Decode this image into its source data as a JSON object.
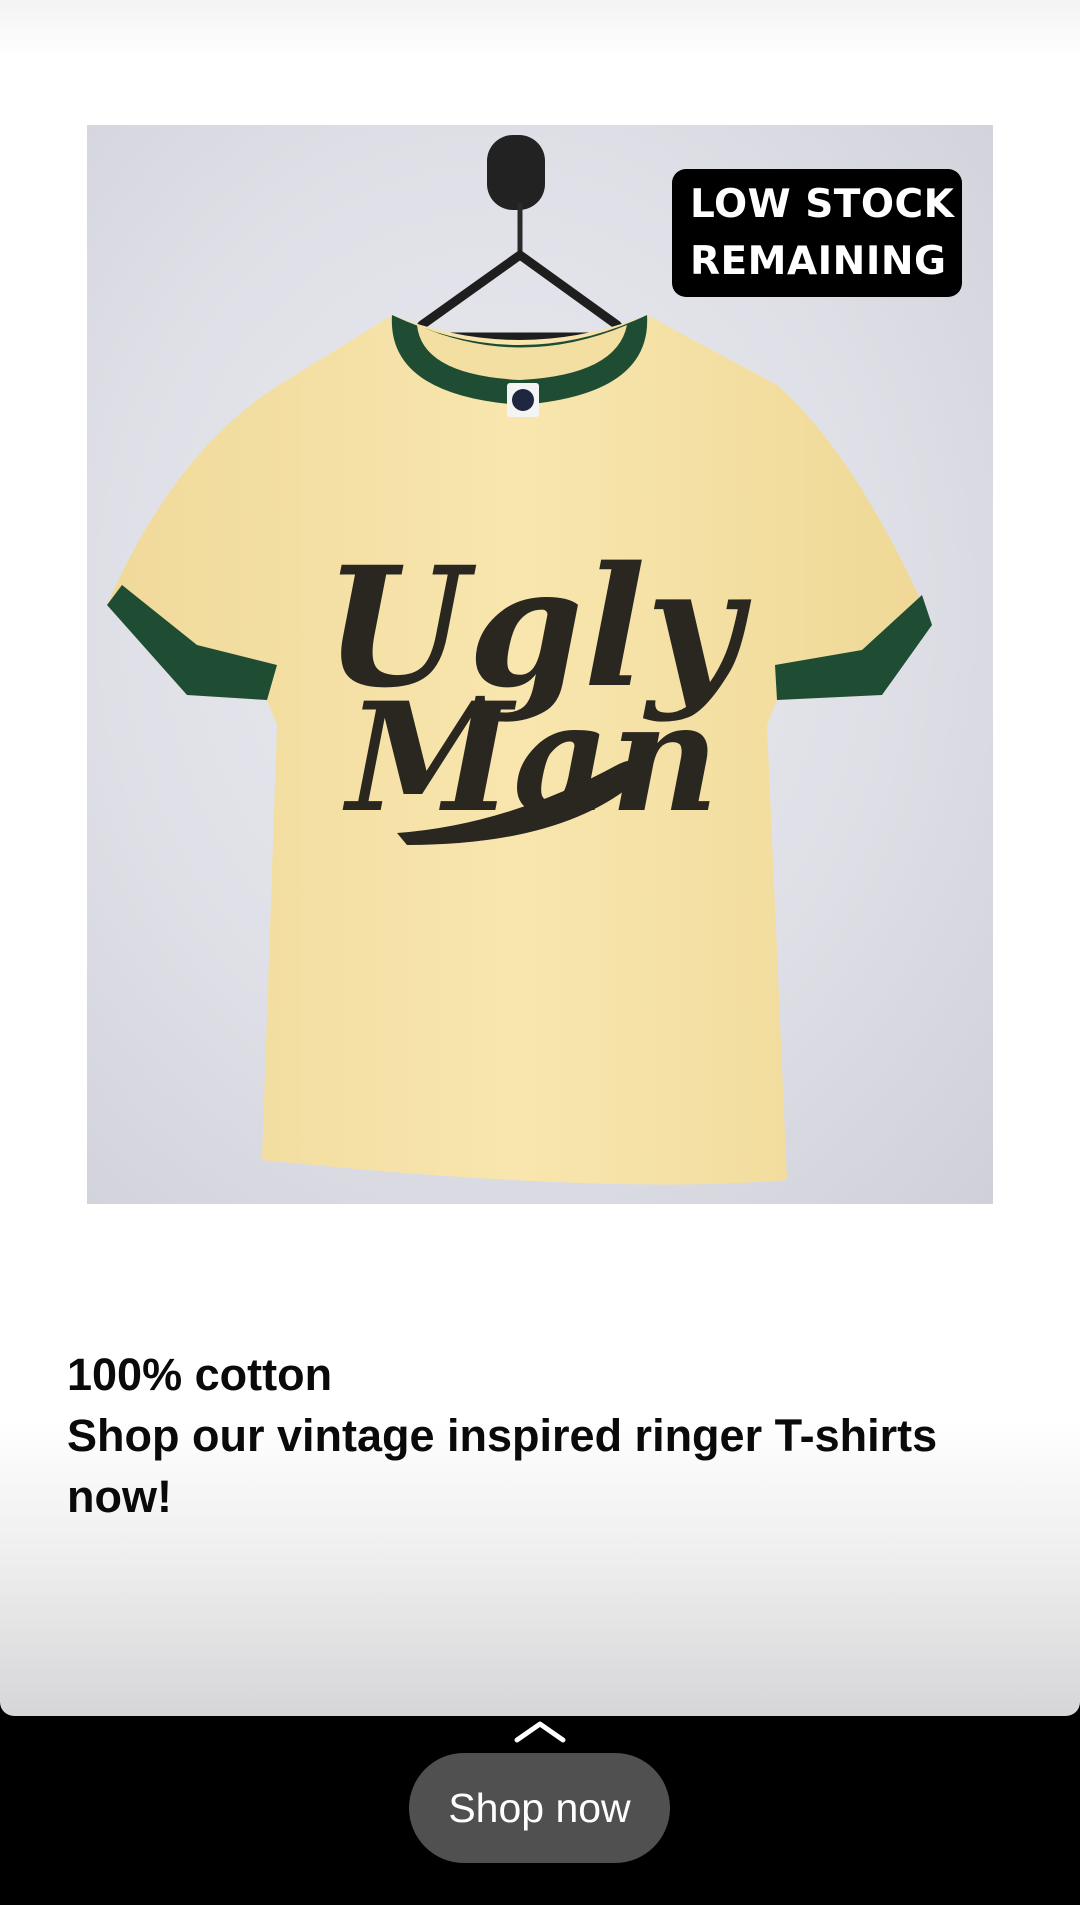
{
  "story": {
    "badge": {
      "line1": "LOW STOCK",
      "line2": "REMAINING"
    },
    "caption": {
      "line1": "100% cotton",
      "line2": "Shop our vintage inspired ringer T-shirts now!"
    },
    "product_image": {
      "shirt_print_line1": "Ugly",
      "shirt_print_line2": "Man"
    }
  },
  "cta": {
    "swipe_icon": "chevron-up-icon",
    "label": "Shop now"
  },
  "colors": {
    "shirt": "#f6e2a6",
    "ringer_trim": "#1f4d34",
    "print": "#2a2620",
    "badge_bg": "#000000",
    "button_bg": "#505050",
    "bottom_bar": "#000000"
  }
}
